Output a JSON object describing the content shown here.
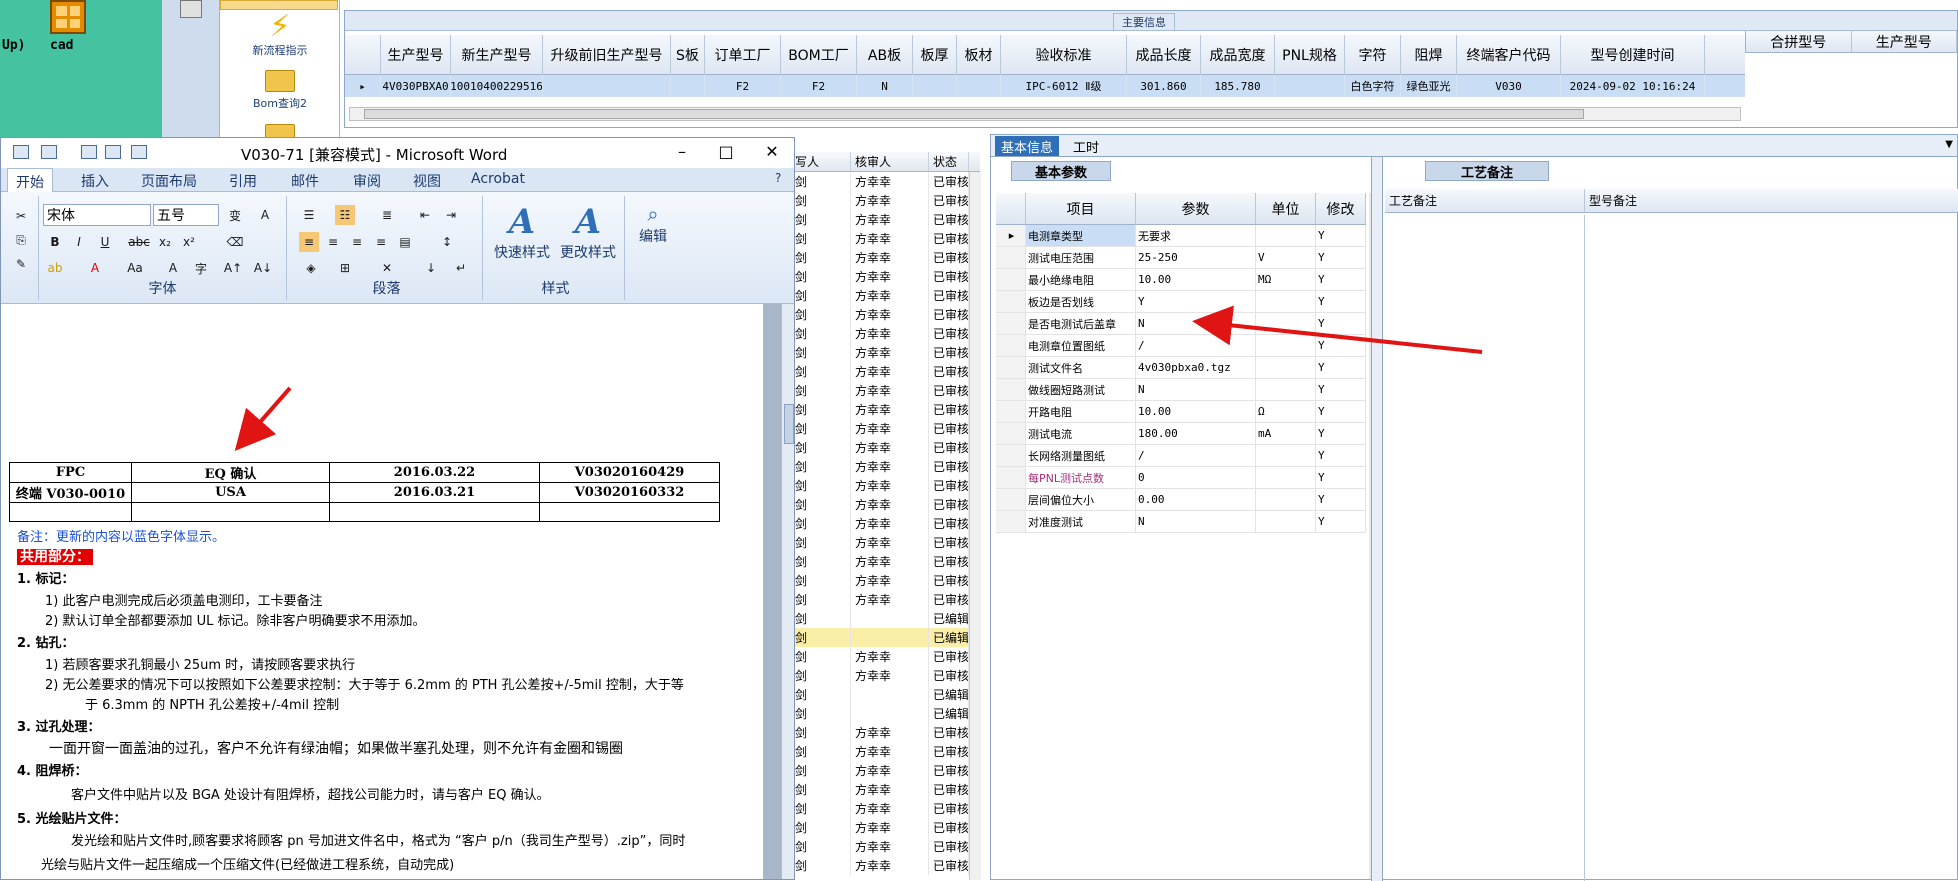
{
  "desktop": {
    "left_label": "Up)",
    "cad_label": "cad"
  },
  "launcher": {
    "item1": "新流程指示",
    "item2": "Bom查询2"
  },
  "main_grid": {
    "title": "主要信息",
    "headers": [
      "生产型号",
      "新生产型号",
      "升级前旧生产型号",
      "S板",
      "订单工厂",
      "BOM工厂",
      "AB板",
      "板厚",
      "板材",
      "验收标准",
      "成品长度",
      "成品宽度",
      "PNL规格",
      "字符",
      "阻焊",
      "终端客户代码",
      "型号创建时间"
    ],
    "right_headers": [
      "合拼型号",
      "生产型号"
    ],
    "row": [
      "4V030PBXA0",
      "10010400229516",
      "",
      "",
      "F2",
      "F2",
      "N",
      "",
      "",
      "IPC-6012 Ⅱ级",
      "301.860",
      "185.780",
      "",
      "白色字符",
      "绿色亚光",
      "V030",
      "2024-09-02 10:16:24"
    ]
  },
  "approval": {
    "headers": [
      "写人",
      "核审人",
      "状态"
    ],
    "rows": [
      [
        "剑",
        "方幸幸",
        "已审核"
      ],
      [
        "剑",
        "方幸幸",
        "已审核"
      ],
      [
        "剑",
        "方幸幸",
        "已审核"
      ],
      [
        "剑",
        "方幸幸",
        "已审核"
      ],
      [
        "剑",
        "方幸幸",
        "已审核"
      ],
      [
        "剑",
        "方幸幸",
        "已审核"
      ],
      [
        "剑",
        "方幸幸",
        "已审核"
      ],
      [
        "剑",
        "方幸幸",
        "已审核"
      ],
      [
        "剑",
        "方幸幸",
        "已审核"
      ],
      [
        "剑",
        "方幸幸",
        "已审核"
      ],
      [
        "剑",
        "方幸幸",
        "已审核"
      ],
      [
        "剑",
        "方幸幸",
        "已审核"
      ],
      [
        "剑",
        "方幸幸",
        "已审核"
      ],
      [
        "剑",
        "方幸幸",
        "已审核"
      ],
      [
        "剑",
        "方幸幸",
        "已审核"
      ],
      [
        "剑",
        "方幸幸",
        "已审核"
      ],
      [
        "剑",
        "方幸幸",
        "已审核"
      ],
      [
        "剑",
        "方幸幸",
        "已审核"
      ],
      [
        "剑",
        "方幸幸",
        "已审核"
      ],
      [
        "剑",
        "方幸幸",
        "已审核"
      ],
      [
        "剑",
        "方幸幸",
        "已审核"
      ],
      [
        "剑",
        "方幸幸",
        "已审核"
      ],
      [
        "剑",
        "方幸幸",
        "已审核"
      ],
      [
        "剑",
        "",
        "已编辑"
      ],
      [
        "剑",
        "",
        "已编辑"
      ],
      [
        "剑",
        "方幸幸",
        "已审核"
      ],
      [
        "剑",
        "方幸幸",
        "已审核"
      ],
      [
        "剑",
        "",
        "已编辑"
      ],
      [
        "剑",
        "",
        "已编辑"
      ],
      [
        "剑",
        "方幸幸",
        "已审核"
      ],
      [
        "剑",
        "方幸幸",
        "已审核"
      ],
      [
        "剑",
        "方幸幸",
        "已审核"
      ],
      [
        "剑",
        "方幸幸",
        "已审核"
      ],
      [
        "剑",
        "方幸幸",
        "已审核"
      ],
      [
        "剑",
        "方幸幸",
        "已审核"
      ],
      [
        "剑",
        "方幸幸",
        "已审核"
      ],
      [
        "剑",
        "方幸幸",
        "已审核"
      ]
    ],
    "highlight_row": 24
  },
  "info": {
    "tabs": [
      "基本信息",
      "工时"
    ],
    "sub_tab_left": "基本参数",
    "sub_tab_right": "工艺备注",
    "param_headers": [
      "项目",
      "参数",
      "单位",
      "修改"
    ],
    "params": [
      [
        "电测章类型",
        "无要求",
        "",
        "Y"
      ],
      [
        "测试电压范围",
        "25-250",
        "V",
        "Y"
      ],
      [
        "最小绝缘电阻",
        "10.00",
        "MΩ",
        "Y"
      ],
      [
        "板边是否划线",
        "Y",
        "",
        "Y"
      ],
      [
        "是否电测试后盖章",
        "N",
        "",
        "Y"
      ],
      [
        "电测章位置图纸",
        "/",
        "",
        "Y"
      ],
      [
        "测试文件名",
        "4v030pbxa0.tgz",
        "",
        "Y"
      ],
      [
        "做线圈短路测试",
        "N",
        "",
        "Y"
      ],
      [
        "开路电阻",
        "10.00",
        "Ω",
        "Y"
      ],
      [
        "测试电流",
        "180.00",
        "mA",
        "Y"
      ],
      [
        "长网络测量图纸",
        "/",
        "",
        "Y"
      ],
      [
        "每PNL测试点数",
        "0",
        "",
        "Y"
      ],
      [
        "层间偏位大小",
        "0.00",
        "",
        "Y"
      ],
      [
        "对准度测试",
        "N",
        "",
        "Y"
      ]
    ],
    "craft_headers": [
      "工艺备注",
      "型号备注"
    ]
  },
  "word": {
    "title": "V030-71 [兼容模式] - Microsoft Word",
    "tabs": [
      "开始",
      "插入",
      "页面布局",
      "引用",
      "邮件",
      "审阅",
      "视图",
      "Acrobat"
    ],
    "font_name": "宋体",
    "font_size": "五号",
    "group_font": "字体",
    "group_paragraph": "段落",
    "group_styles": "样式",
    "quick_style": "快速样式",
    "change_style": "更改样式",
    "edit_label": "编辑",
    "table_rows": [
      [
        "FPC",
        "EQ 确认",
        "2016.03.22",
        "V03020160429"
      ],
      [
        "终端 V030-0010",
        "USA",
        "2016.03.21",
        "V03020160332"
      ],
      [
        "",
        "",
        "",
        ""
      ]
    ],
    "note": "备注：更新的内容以蓝色字体显示。",
    "common": "共用部分：",
    "s1": "1.   标记：",
    "s1_1": "1)  此客户电测完成后必须盖电测印，工卡要备注",
    "s1_2": "2)  默认订单全部都要添加 UL 标记。除非客户明确要求不用添加。",
    "s2": "2.   钻孔：",
    "s2_1": "1)  若顾客要求孔铜最小 25um 时，请按顾客要求执行",
    "s2_2a": "2)  无公差要求的情况下可以按照如下公差要求控制：大于等于 6.2mm 的 PTH 孔公差按+/-5mil 控制，大于等",
    "s2_2b": "于 6.3mm 的 NPTH 孔公差按+/-4mil 控制",
    "s3": "3. 过孔处理：",
    "s3_1": "一面开窗一面盖油的过孔，客户不允许有绿油帽；如果做半塞孔处理，则不允许有金圈和锡圈",
    "s4": "4. 阻焊桥：",
    "s4_1": "客户文件中贴片以及 BGA 处设计有阻焊桥，超找公司能力时，请与客户 EQ 确认。",
    "s5": "5. 光绘贴片文件：",
    "s5_1": "发光绘和贴片文件时,顾客要求将顾客 pn 号加进文件名中，格式为 “客户 p/n（我司生产型号）.zip”，同时",
    "s5_2": "光绘与贴片文件一起压缩成一个压缩文件(已经做进工程系统，自动完成)"
  },
  "colors": {
    "accent": "#2f6fb8",
    "arrow": "#e11414",
    "selection": "#c9ddf5",
    "highlight": "#fbeea6"
  }
}
